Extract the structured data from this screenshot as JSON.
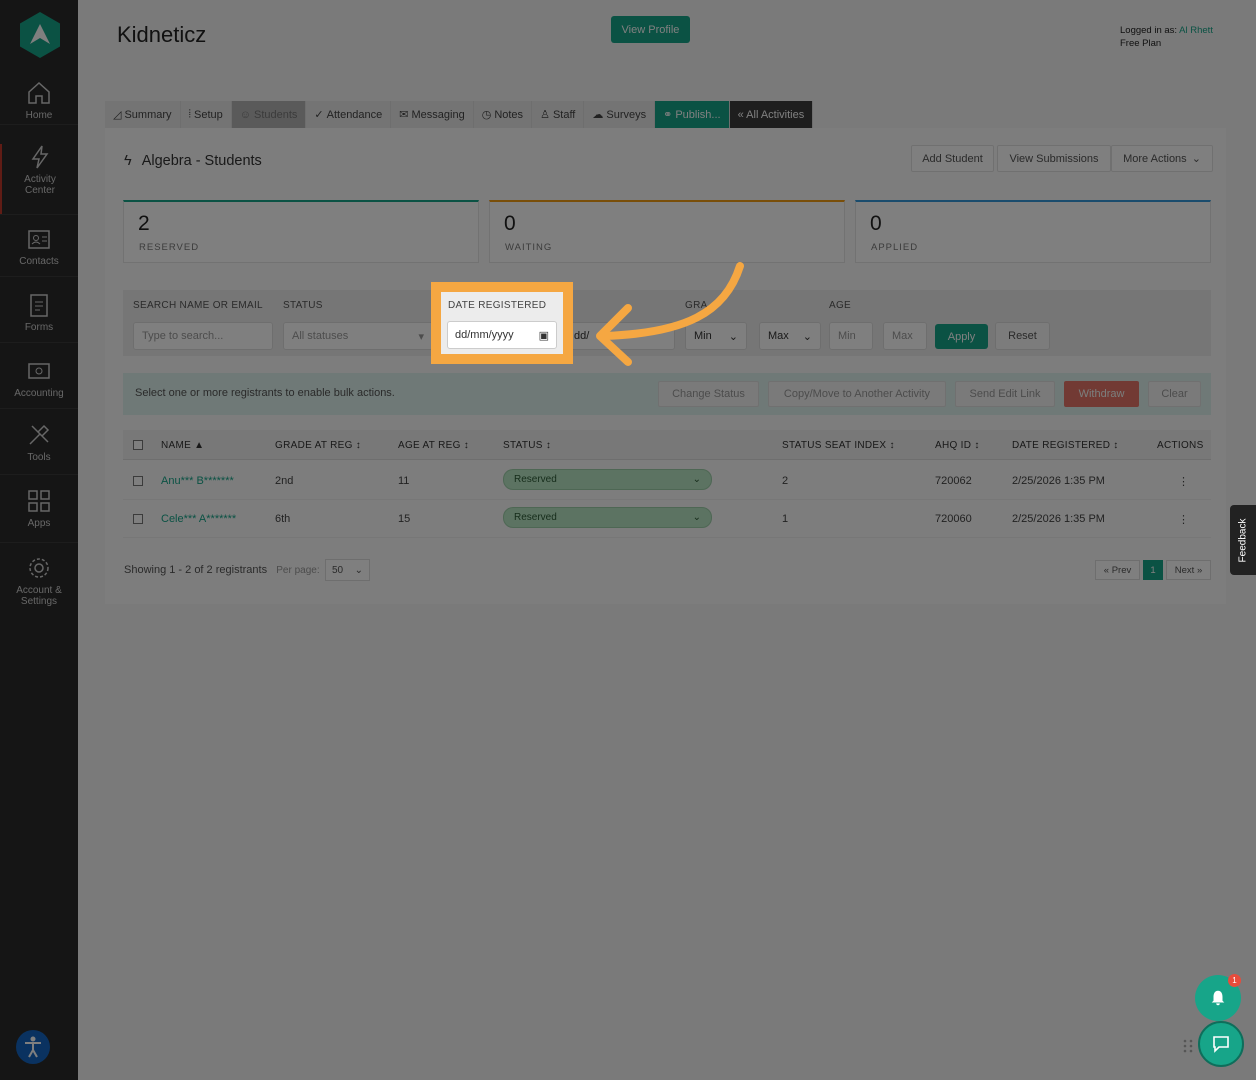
{
  "app": {
    "title": "Kidneticz",
    "view_profile_label": "View Profile",
    "logged_in_prefix": "Logged in as:",
    "user_name": "Al Rhett",
    "plan": "Free Plan"
  },
  "sidebar": {
    "items": [
      {
        "label": "Home",
        "icon": "home-icon"
      },
      {
        "label": "Activity\nCenter",
        "icon": "lightning-icon"
      },
      {
        "label": "Contacts",
        "icon": "contacts-icon"
      },
      {
        "label": "Forms",
        "icon": "forms-icon"
      },
      {
        "label": "Accounting",
        "icon": "accounting-icon"
      },
      {
        "label": "Tools",
        "icon": "tools-icon"
      },
      {
        "label": "Apps",
        "icon": "apps-icon"
      },
      {
        "label": "Account &\nSettings",
        "icon": "gear-icon"
      }
    ]
  },
  "tabs": [
    {
      "label": "Summary"
    },
    {
      "label": "Setup"
    },
    {
      "label": "Students"
    },
    {
      "label": "Attendance"
    },
    {
      "label": "Messaging"
    },
    {
      "label": "Notes"
    },
    {
      "label": "Staff"
    },
    {
      "label": "Surveys"
    },
    {
      "label": "Publish..."
    },
    {
      "label": "« All Activities"
    }
  ],
  "page": {
    "section_title": "Algebra - Students",
    "add_student": "Add Student",
    "view_submissions": "View Submissions",
    "more_actions": "More Actions"
  },
  "stats": [
    {
      "value": "2",
      "label": "RESERVED",
      "color": "#17a589"
    },
    {
      "value": "0",
      "label": "WAITING",
      "color": "#f39c12"
    },
    {
      "value": "0",
      "label": "APPLIED",
      "color": "#3498db"
    }
  ],
  "filters": {
    "search_label": "SEARCH NAME OR EMAIL",
    "search_placeholder": "Type to search...",
    "status_label": "STATUS",
    "status_value": "All statuses",
    "date_label": "DATE REGISTERED",
    "date_from": "dd/mm/yyyy",
    "date_to_partial": "dd/",
    "grade_label": "GRA",
    "grade_min": "Min",
    "grade_max": "Max",
    "age_label": "AGE",
    "age_min": "Min",
    "age_max": "Max",
    "apply": "Apply",
    "reset": "Reset"
  },
  "bulk": {
    "text": "Select one or more registrants to enable bulk actions.",
    "change_status": "Change Status",
    "copy_move": "Copy/Move to Another Activity",
    "send_edit_link": "Send Edit Link",
    "withdraw": "Withdraw",
    "clear": "Clear"
  },
  "table": {
    "headers": [
      "NAME ▲",
      "GRADE AT REG ↕",
      "AGE AT REG ↕",
      "STATUS ↕",
      "STATUS SEAT INDEX ↕",
      "AHQ ID ↕",
      "DATE REGISTERED ↕",
      "ACTIONS"
    ],
    "rows": [
      {
        "name": "Anu*** B*******",
        "grade": "2nd",
        "age": "11",
        "status": "Reserved",
        "seat": "2",
        "ahq": "720062",
        "date": "2/25/2026 1:35 PM",
        "actions": "⋮"
      },
      {
        "name": "Cele*** A*******",
        "grade": "6th",
        "age": "15",
        "status": "Reserved",
        "seat": "1",
        "ahq": "720060",
        "date": "2/25/2026 1:35 PM",
        "actions": "⋮"
      }
    ]
  },
  "footer": {
    "showing": "Showing 1 - 2 of 2 registrants",
    "per_page_label": "Per page:",
    "per_page_value": "50",
    "prev": "« Prev",
    "current_page": "1",
    "next": "Next »"
  },
  "widgets": {
    "feedback": "Feedback",
    "notification_count": "1"
  }
}
